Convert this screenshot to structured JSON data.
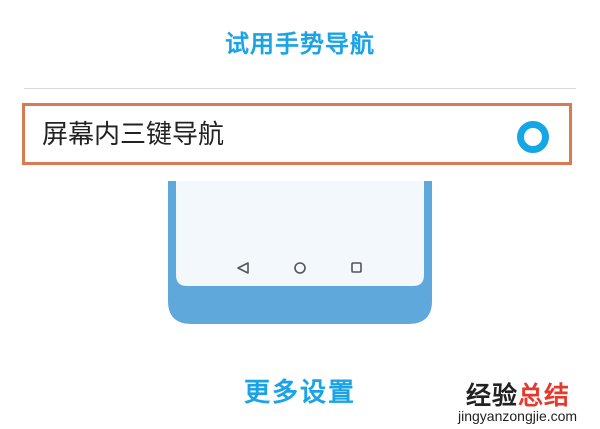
{
  "header": {
    "try_gesture_label": "试用手势导航"
  },
  "option": {
    "label": "屏幕内三键导航",
    "selected": true
  },
  "illustration": {
    "nav_buttons": [
      "back-icon",
      "home-icon",
      "recents-icon"
    ],
    "colors": {
      "frame": "#5fa8dc",
      "screen": "#f2f8fc",
      "nav_icon": "#555555"
    }
  },
  "footer": {
    "more_settings_label": "更多设置"
  },
  "watermark": {
    "brand_black": "经验",
    "brand_red": "总结",
    "domain": "jingyanzongjie.com"
  },
  "colors": {
    "accent": "#1aa3e6",
    "highlight_border": "#d97a50",
    "radio": "#15a6e8",
    "divider": "#d9d9d9"
  }
}
